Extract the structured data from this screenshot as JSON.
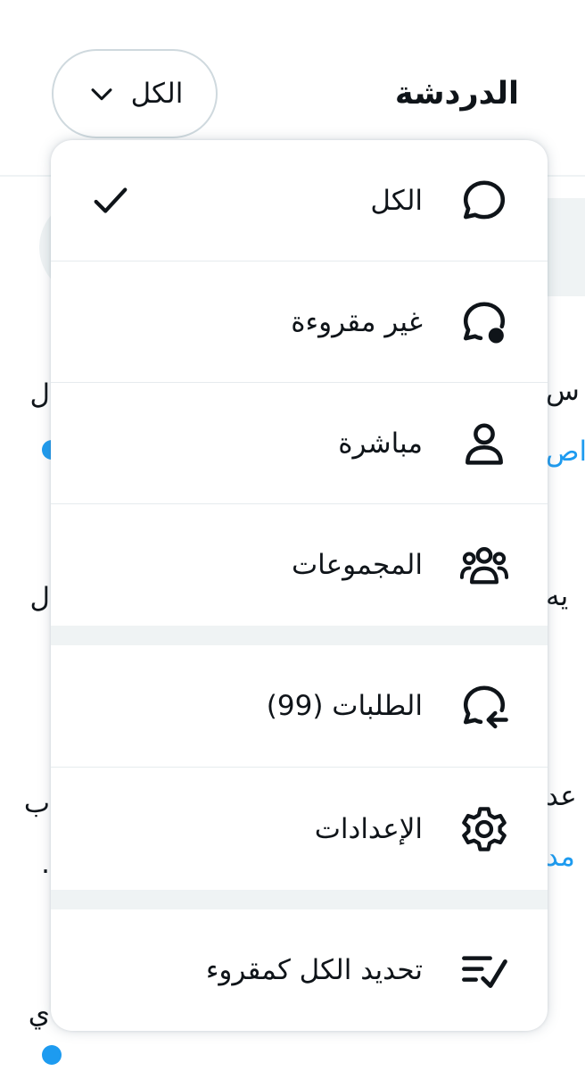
{
  "header": {
    "title": "الدردشة",
    "filter_label": "الكل"
  },
  "menu": {
    "items": [
      {
        "label": "الكل",
        "icon": "chat-bubble-icon",
        "selected": true
      },
      {
        "label": "غير مقروءة",
        "icon": "unread-chat-icon"
      },
      {
        "label": "مباشرة",
        "icon": "person-icon"
      },
      {
        "label": "المجموعات",
        "icon": "group-icon"
      },
      {
        "label": "الطلبات (99)",
        "icon": "message-request-icon"
      },
      {
        "label": "الإعدادات",
        "icon": "gear-icon"
      },
      {
        "label": "تحديد الكل كمقروء",
        "icon": "mark-read-icon"
      }
    ]
  },
  "background": {
    "row1_left": "ل",
    "row1_right": "ن س",
    "row1_right_sub": "اص",
    "row2_left": "ل",
    "row2_right": "يه",
    "row3_left": "ب",
    "row3_right": "عد",
    "row3_right_sub": "مد",
    "row3_left_sub": ".",
    "row4_left": "ي"
  },
  "colors": {
    "accent": "#1d9bf0",
    "text": "#0f1419",
    "border": "#cfd9de",
    "separator": "#eff3f4"
  }
}
